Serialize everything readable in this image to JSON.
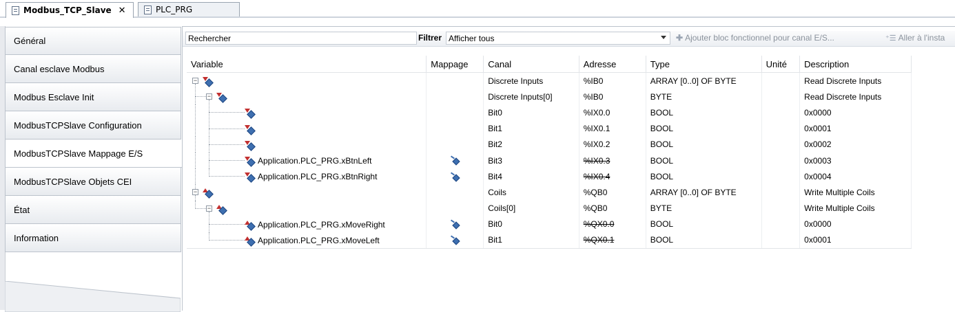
{
  "tabs": [
    {
      "label": "Modbus_TCP_Slave",
      "active": true,
      "close": "✕"
    },
    {
      "label": "PLC_PRG",
      "active": false
    }
  ],
  "nav": {
    "items": [
      {
        "label": "Général"
      },
      {
        "label": "Canal esclave Modbus"
      },
      {
        "label": "Modbus Esclave Init"
      },
      {
        "label": "ModbusTCPSlave Configuration"
      },
      {
        "label": "ModbusTCPSlave Mappage E/S",
        "selected": true
      },
      {
        "label": "ModbusTCPSlave Objets CEI"
      },
      {
        "label": "État"
      },
      {
        "label": "Information"
      }
    ]
  },
  "toolbar": {
    "search_label": "Rechercher",
    "filter_label": "Filtrer",
    "filter_value": "Afficher tous",
    "add_fb_label": "Ajouter bloc fonctionnel pour canal E/S...",
    "goto_label": "Aller à l'insta"
  },
  "grid": {
    "headers": [
      "Variable",
      "Mappage",
      "Canal",
      "Adresse",
      "Type",
      "Unité",
      "Description"
    ],
    "rows": [
      {
        "variable": "",
        "canal": "Discrete Inputs",
        "adresse": "%IB0",
        "type": "ARRAY [0..0] OF BYTE",
        "description": "Read Discrete Inputs"
      },
      {
        "variable": "",
        "canal": "Discrete Inputs[0]",
        "adresse": "%IB0",
        "type": "BYTE",
        "description": "Read Discrete Inputs"
      },
      {
        "variable": "",
        "canal": "Bit0",
        "adresse": "%IX0.0",
        "type": "BOOL",
        "description": "0x0000"
      },
      {
        "variable": "",
        "canal": "Bit1",
        "adresse": "%IX0.1",
        "type": "BOOL",
        "description": "0x0001"
      },
      {
        "variable": "",
        "canal": "Bit2",
        "adresse": "%IX0.2",
        "type": "BOOL",
        "description": "0x0002"
      },
      {
        "variable": "Application.PLC_PRG.xBtnLeft",
        "canal": "Bit3",
        "adresse": "%IX0.3",
        "type": "BOOL",
        "description": "0x0003"
      },
      {
        "variable": "Application.PLC_PRG.xBtnRight",
        "canal": "Bit4",
        "adresse": "%IX0.4",
        "type": "BOOL",
        "description": "0x0004"
      },
      {
        "variable": "",
        "canal": "Coils",
        "adresse": "%QB0",
        "type": "ARRAY [0..0] OF BYTE",
        "description": "Write Multiple Coils"
      },
      {
        "variable": "",
        "canal": "Coils[0]",
        "adresse": "%QB0",
        "type": "BYTE",
        "description": "Write Multiple Coils"
      },
      {
        "variable": "Application.PLC_PRG.xMoveRight",
        "canal": "Bit0",
        "adresse": "%QX0.0",
        "type": "BOOL",
        "description": "0x0000"
      },
      {
        "variable": "Application.PLC_PRG.xMoveLeft",
        "canal": "Bit1",
        "adresse": "%QX0.1",
        "type": "BOOL",
        "description": "0x0001"
      }
    ]
  },
  "colors": {
    "input_arrow": "#c23030",
    "variable_body": "#3e6fb0"
  }
}
